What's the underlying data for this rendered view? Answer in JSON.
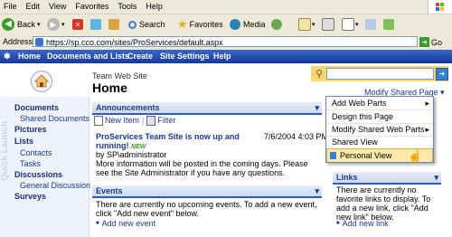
{
  "menubar": [
    "File",
    "Edit",
    "View",
    "Favorites",
    "Tools",
    "Help"
  ],
  "toolbar": {
    "back": "Back",
    "search": "Search",
    "favorites": "Favorites",
    "media": "Media"
  },
  "address": {
    "label": "Address",
    "url": "https://sp.cco.com/sites/ProServices/default.aspx",
    "go": "Go"
  },
  "spnav": [
    "Home",
    "Documents and Lists",
    "Create",
    "Site Settings",
    "Help"
  ],
  "header": {
    "site": "Team Web Site",
    "page": "Home",
    "modify": "Modify Shared Page ▾"
  },
  "quicklaunch": {
    "vertical": "Quick Launch",
    "items": [
      {
        "label": "Documents",
        "heading": true
      },
      {
        "label": "Shared Documents",
        "heading": false
      },
      {
        "label": "Pictures",
        "heading": true
      },
      {
        "label": "Lists",
        "heading": true
      },
      {
        "label": "Contacts",
        "heading": false
      },
      {
        "label": "Tasks",
        "heading": false
      },
      {
        "label": "Discussions",
        "heading": true
      },
      {
        "label": "General Discussion",
        "heading": false
      },
      {
        "label": "Surveys",
        "heading": true
      }
    ]
  },
  "announcements": {
    "title": "Announcements",
    "new_item": "New Item",
    "filter": "Filter",
    "headline": "ProServices Team Site is now up and running!",
    "new_badge": "NEW",
    "date": "7/6/2004 4:03 PM",
    "by": "by SP\\administrator",
    "body": "More information will be posted in the coming days. Please see the Site Administrator if you have any questions."
  },
  "events": {
    "title": "Events",
    "body": "There are currently no upcoming events. To add a new event, click \"Add new event\" below.",
    "add": "Add new event"
  },
  "links": {
    "title": "Links",
    "body": "There are currently no favorite links to display. To add a new link, click \"Add new link\" below.",
    "add": "Add new link"
  },
  "dropdown": [
    "Add Web Parts",
    "Design this Page",
    "Modify Shared Web Parts",
    "Shared View",
    "Personal View"
  ],
  "colors": {
    "nav": "#1f4aa8",
    "accent": "#2e5ac4",
    "highlight": "#ffd56e"
  }
}
